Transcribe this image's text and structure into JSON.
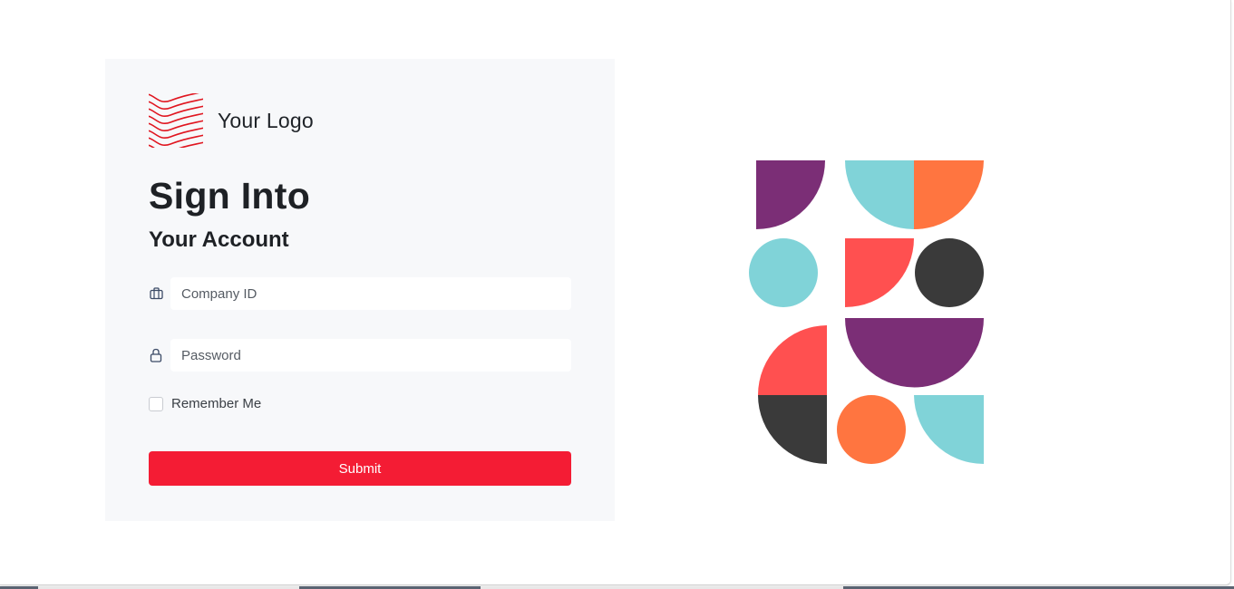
{
  "brand": {
    "logo_text": "Your Logo",
    "logo_icon": "wavy-lines-logo-icon",
    "accent_color": "#f41c34"
  },
  "form": {
    "heading": "Sign Into",
    "subheading": "Your Account",
    "company_id": {
      "icon": "briefcase-icon",
      "placeholder": "Company ID",
      "value": ""
    },
    "password": {
      "icon": "lock-icon",
      "placeholder": "Password",
      "value": ""
    },
    "remember_me": {
      "label": "Remember Me",
      "checked": false
    },
    "submit_label": "Submit"
  },
  "illustration": {
    "palette": {
      "purple": "#7b2e76",
      "teal": "#80d3d8",
      "orange": "#ff7540",
      "coral": "#ff5050",
      "charcoal": "#3a3a3a"
    }
  }
}
